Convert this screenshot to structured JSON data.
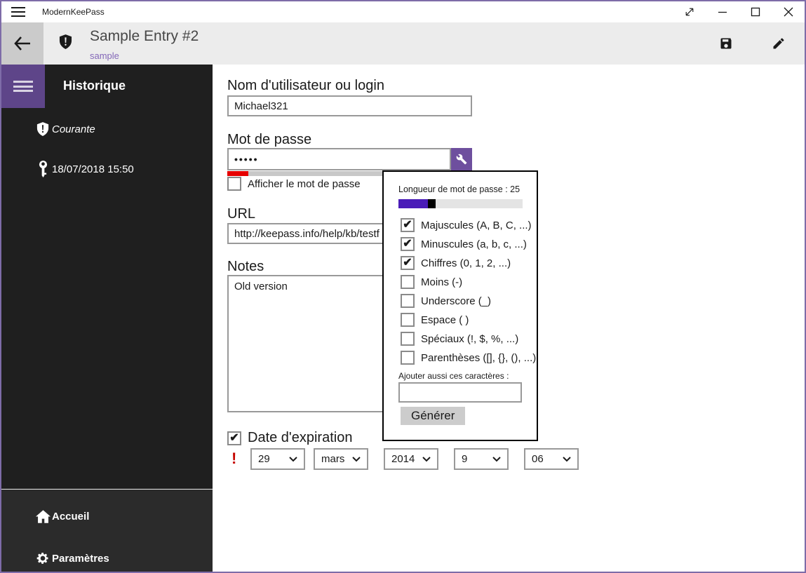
{
  "window": {
    "title": "ModernKeePass",
    "controls": {
      "fullscreen": "diagonal-resize-arrow",
      "minimize": "—",
      "maximize": "□",
      "close": "✕"
    }
  },
  "app_bar": {
    "title": "Sample Entry #2",
    "subtitle": "sample"
  },
  "sidebar": {
    "heading": "Historique",
    "items": [
      {
        "icon": "shield-exclamation-icon",
        "label": "Courante"
      },
      {
        "icon": "key-icon",
        "label": "18/07/2018 15:50"
      }
    ],
    "footer_items": [
      {
        "icon": "home-icon",
        "label": "Accueil"
      },
      {
        "icon": "gear-icon",
        "label": "Paramètres"
      }
    ]
  },
  "form": {
    "username_label": "Nom d'utilisateur ou login",
    "username_value": "Michael321",
    "password_label": "Mot de passe",
    "password_value": "•••••",
    "show_password_label": "Afficher le mot de passe",
    "show_password_checked": false,
    "url_label": "URL",
    "url_value": "http://keepass.info/help/kb/testf",
    "notes_label": "Notes",
    "notes_value": "Old version",
    "expiration_label": "Date d'expiration",
    "expiration_checked": true,
    "expiration_warning": "!",
    "date_parts": [
      {
        "value": "29"
      },
      {
        "value": "mars"
      },
      {
        "value": "2014"
      },
      {
        "value": "9"
      },
      {
        "value": "06"
      }
    ]
  },
  "generator_popup": {
    "length_label": "Longueur de mot de passe : 25",
    "length_value": 25,
    "slider_percent": 24,
    "options": [
      {
        "label": "Majuscules (A, B, C, ...)",
        "checked": true
      },
      {
        "label": "Minuscules (a, b, c, ...)",
        "checked": true
      },
      {
        "label": "Chiffres (0, 1, 2, ...)",
        "checked": true
      },
      {
        "label": "Moins (-)",
        "checked": false
      },
      {
        "label": "Underscore (_)",
        "checked": false
      },
      {
        "label": "Espace ( )",
        "checked": false
      },
      {
        "label": "Spéciaux (!, $, %, ...)",
        "checked": false
      },
      {
        "label": "Parenthèses ([], {}, (), ...)",
        "checked": false
      }
    ],
    "add_chars_label": "Ajouter aussi ces caractères :",
    "add_chars_value": "",
    "generate_label": "Générer"
  },
  "icons": {
    "checkmark": "✔",
    "hamburger": "≡",
    "back_arrow": "←",
    "chevron_down": "⌄",
    "fullscreen": "⤢",
    "minimize": "—",
    "maximize": "□",
    "close": "✕"
  },
  "colors": {
    "window_border": "#7e6ca8",
    "accent_purple": "#5e4589",
    "wrench_button": "#6e4f9e",
    "slider_fill": "#4a1cb8",
    "subtitle_purple": "#8468b8",
    "strength_red": "#e60000",
    "warning_red": "#c50500",
    "sidebar_bg": "#1f1f1f",
    "sidebar_footer_bg": "#2b2b2b",
    "appbar_bg": "#ececec"
  }
}
